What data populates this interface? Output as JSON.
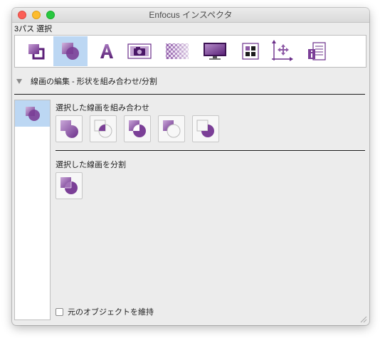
{
  "window": {
    "title": "Enfocus インスペクタ"
  },
  "selection_info": "3パス 選択",
  "toolbar": {
    "tools": [
      {
        "name": "arrange-tool",
        "active": false
      },
      {
        "name": "pathfinder-tool",
        "active": true
      },
      {
        "name": "text-tool",
        "active": false
      },
      {
        "name": "image-tool",
        "active": false
      },
      {
        "name": "transparency-tool",
        "active": false
      },
      {
        "name": "display-tool",
        "active": false
      },
      {
        "name": "grid-tool",
        "active": false
      },
      {
        "name": "position-tool",
        "active": false
      },
      {
        "name": "document-tool",
        "active": false
      }
    ]
  },
  "section": {
    "title": "線画の編集 - 形状を組み合わせ/分割"
  },
  "combine_group": {
    "label": "選択した線画を組み合わせ"
  },
  "split_group": {
    "label": "選択した線画を分割"
  },
  "keep_original": {
    "label": "元のオブジェクトを維持",
    "checked": false
  },
  "colors": {
    "accent_purple": "#7b3f97",
    "active_blue": "#bcd7f3"
  }
}
